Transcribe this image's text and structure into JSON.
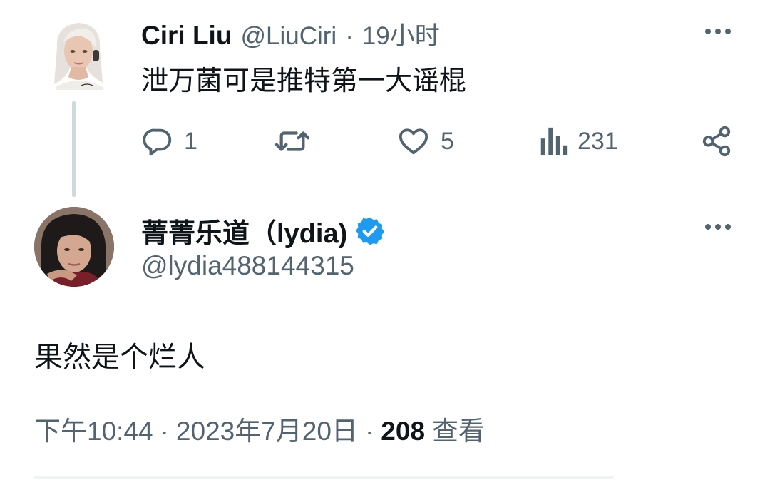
{
  "parent_tweet": {
    "author_name": "Ciri Liu",
    "handle": "@LiuCiri",
    "separator": "·",
    "time": "19小时",
    "text": "泄万菌可是推特第一大谣棍",
    "avatar_icon": "avatar-illustration-ciri",
    "actions": {
      "reply": {
        "icon": "reply-icon",
        "count": "1"
      },
      "retweet": {
        "icon": "retweet-icon",
        "count": ""
      },
      "like": {
        "icon": "like-icon",
        "count": "5"
      },
      "views": {
        "icon": "views-icon",
        "count": "231"
      },
      "share": {
        "icon": "share-icon"
      }
    }
  },
  "main_tweet": {
    "author_name": "菁菁乐道（lydia)",
    "verified": true,
    "handle": "@lydia488144315",
    "text": "果然是个烂人",
    "time": "下午10:44",
    "sep1": "·",
    "date": "2023年7月20日",
    "sep2": "·",
    "views_count": "208",
    "views_label": "查看"
  },
  "colors": {
    "text": "#0f1419",
    "muted": "#536471",
    "verified": "#1d9bf0",
    "thread_line": "#cfd9de"
  }
}
